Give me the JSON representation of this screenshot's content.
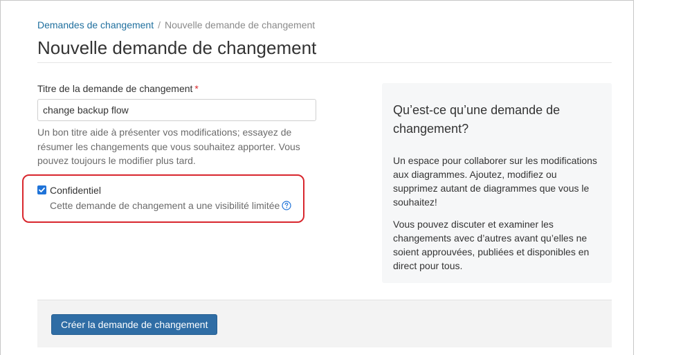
{
  "breadcrumb": {
    "parent": "Demandes de changement",
    "separator": "/",
    "current": "Nouvelle demande de changement"
  },
  "page": {
    "title": "Nouvelle demande de changement"
  },
  "form": {
    "title_label": "Titre de la demande de changement",
    "required_marker": "*",
    "title_value": "change backup flow",
    "title_help": "Un bon titre aide à présenter vos modifications; essayez de résumer les changements que vous souhaitez apporter. Vous pouvez toujours le modifier plus tard.",
    "confidential": {
      "checked": true,
      "label": "Confidentiel",
      "description": "Cette demande de changement a une visibilité limitée",
      "icon": "help-circle-icon"
    }
  },
  "sidebar": {
    "title": "Qu’est-ce qu’une demande de changement?",
    "paragraph1": "Un espace pour collaborer sur les modifications aux diagrammes. Ajoutez, modifiez ou supprimez autant de diagrammes que vous le souhaitez!",
    "paragraph2": "Vous pouvez discuter et examiner les changements avec d’autres avant qu’elles ne soient approuvées, publiées et disponibles en direct pour tous."
  },
  "footer": {
    "submit_label": "Créer la demande de changement"
  },
  "colors": {
    "link": "#1f6f9e",
    "primary_button": "#2f6da5",
    "highlight_border": "#d8262d",
    "checkbox": "#1f73d8"
  }
}
